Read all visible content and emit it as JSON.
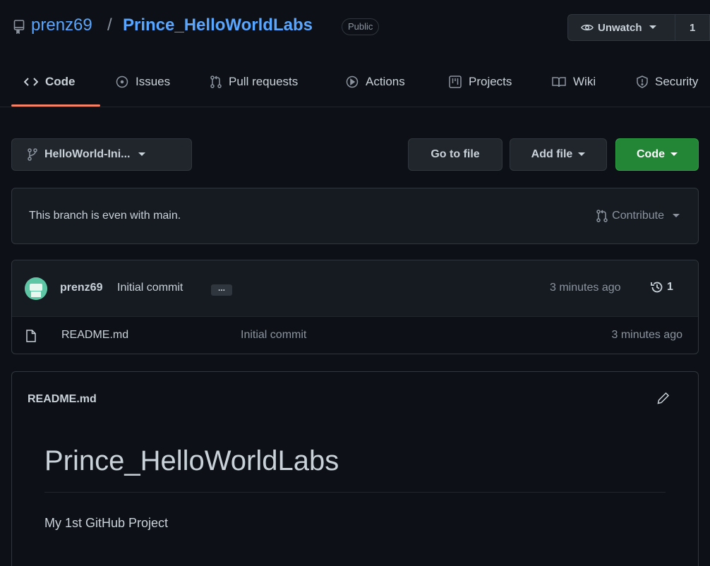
{
  "repo": {
    "owner": "prenz69",
    "separator": "/",
    "name": "Prince_HelloWorldLabs",
    "visibility": "Public",
    "watch_label": "Unwatch",
    "watch_count": "1"
  },
  "tabs": [
    {
      "label": "Code",
      "icon": "code-icon"
    },
    {
      "label": "Issues",
      "icon": "issue-icon"
    },
    {
      "label": "Pull requests",
      "icon": "pull-request-icon"
    },
    {
      "label": "Actions",
      "icon": "play-icon"
    },
    {
      "label": "Projects",
      "icon": "project-icon"
    },
    {
      "label": "Wiki",
      "icon": "book-icon"
    },
    {
      "label": "Security",
      "icon": "shield-icon"
    }
  ],
  "toolbar": {
    "branch": "HelloWorld-Ini...",
    "go_to_file": "Go to file",
    "add_file": "Add file",
    "code": "Code"
  },
  "branch_status": {
    "text": "This branch is even with main.",
    "contribute": "Contribute"
  },
  "latest_commit": {
    "user": "prenz69",
    "message": "Initial commit",
    "ellipsis": "...",
    "time": "3 minutes ago",
    "commit_count": "1"
  },
  "files": [
    {
      "name": "README.md",
      "commit": "Initial commit",
      "time": "3 minutes ago",
      "icon": "file-icon"
    }
  ],
  "readme": {
    "filename": "README.md",
    "heading": "Prince_HelloWorldLabs",
    "paragraph": "My 1st GitHub Project"
  },
  "colors": {
    "background": "#0d1117",
    "link": "#58a6ff",
    "tab_underline": "#f78166",
    "primary_button": "#238636"
  }
}
